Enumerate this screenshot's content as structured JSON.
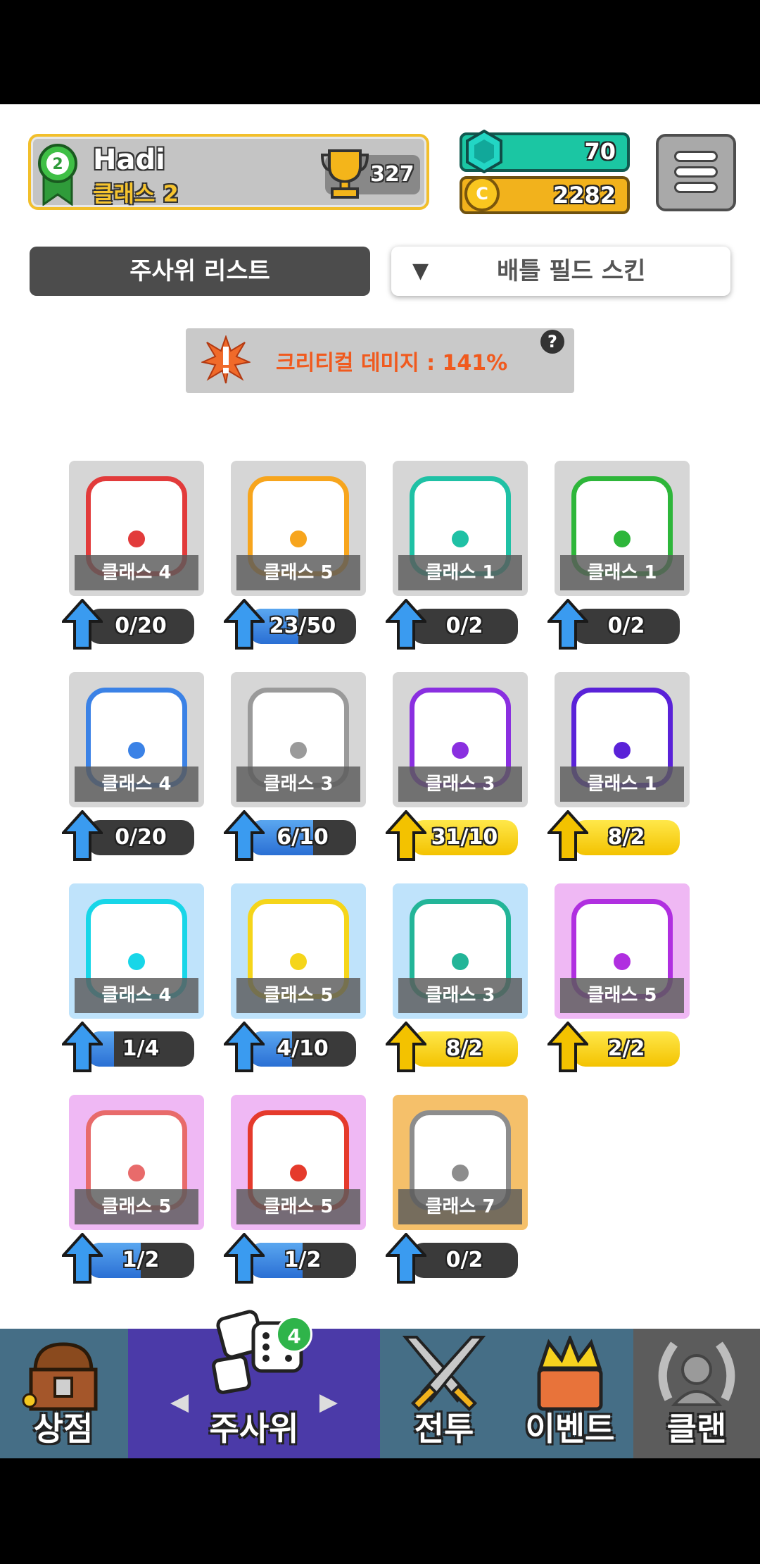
{
  "profile": {
    "name": "Hadi",
    "class_label": "클래스 2",
    "rank_badge": "2",
    "trophies": "327"
  },
  "resources": {
    "gems": "70",
    "coins": "2282",
    "coin_icon_letter": "C"
  },
  "tabs": {
    "dice_list": "주사위 리스트",
    "battle_field_skin": "배틀 필드 스킨"
  },
  "critical": {
    "text": "크리티컬 데미지 : 141%",
    "help": "?"
  },
  "dice": [
    {
      "class_label": "클래스 4",
      "progress_text": "0/20",
      "progress": 0.0,
      "color": "#e23b3b",
      "state": "blue"
    },
    {
      "class_label": "클래스 5",
      "progress_text": "23/50",
      "progress": 0.46,
      "color": "#f7a51d",
      "state": "blue"
    },
    {
      "class_label": "클래스 1",
      "progress_text": "0/2",
      "progress": 0.0,
      "color": "#1fc1a5",
      "state": "blue"
    },
    {
      "class_label": "클래스 1",
      "progress_text": "0/2",
      "progress": 0.0,
      "color": "#2eb63a",
      "state": "blue"
    },
    {
      "class_label": "클래스 4",
      "progress_text": "0/20",
      "progress": 0.0,
      "color": "#3b82e6",
      "state": "blue"
    },
    {
      "class_label": "클래스 3",
      "progress_text": "6/10",
      "progress": 0.6,
      "color": "#9a9a9a",
      "state": "blue"
    },
    {
      "class_label": "클래스 3",
      "progress_text": "31/10",
      "progress": 1.0,
      "color": "#8a2fe0",
      "state": "yellow"
    },
    {
      "class_label": "클래스 1",
      "progress_text": "8/2",
      "progress": 1.0,
      "color": "#5a22d8",
      "state": "yellow"
    },
    {
      "class_label": "클래스 4",
      "progress_text": "1/4",
      "progress": 0.25,
      "color": "#18d6e8",
      "state": "blue"
    },
    {
      "class_label": "클래스 5",
      "progress_text": "4/10",
      "progress": 0.4,
      "color": "#f5d51a",
      "state": "blue"
    },
    {
      "class_label": "클래스 3",
      "progress_text": "8/2",
      "progress": 1.0,
      "color": "#23b598",
      "state": "yellow"
    },
    {
      "class_label": "클래스 5",
      "progress_text": "2/2",
      "progress": 1.0,
      "color": "#b02fe0",
      "state": "yellow"
    },
    {
      "class_label": "클래스 5",
      "progress_text": "1/2",
      "progress": 0.5,
      "color": "#e86b6b",
      "state": "blue"
    },
    {
      "class_label": "클래스 5",
      "progress_text": "1/2",
      "progress": 0.5,
      "color": "#e53a2c",
      "state": "blue"
    },
    {
      "class_label": "클래스 7",
      "progress_text": "0/2",
      "progress": 0.0,
      "color": "#8d8d8d",
      "state": "blue"
    }
  ],
  "nav": {
    "shop": "상점",
    "dice": "주사위",
    "battle": "전투",
    "event": "이벤트",
    "clan": "클랜",
    "dice_badge": "4"
  },
  "colors": {
    "blue_fill": "#2a6fd4",
    "yellow_fill": "#f3c200",
    "nav_bg": "#456e86",
    "nav_active": "#4b3aa8"
  }
}
